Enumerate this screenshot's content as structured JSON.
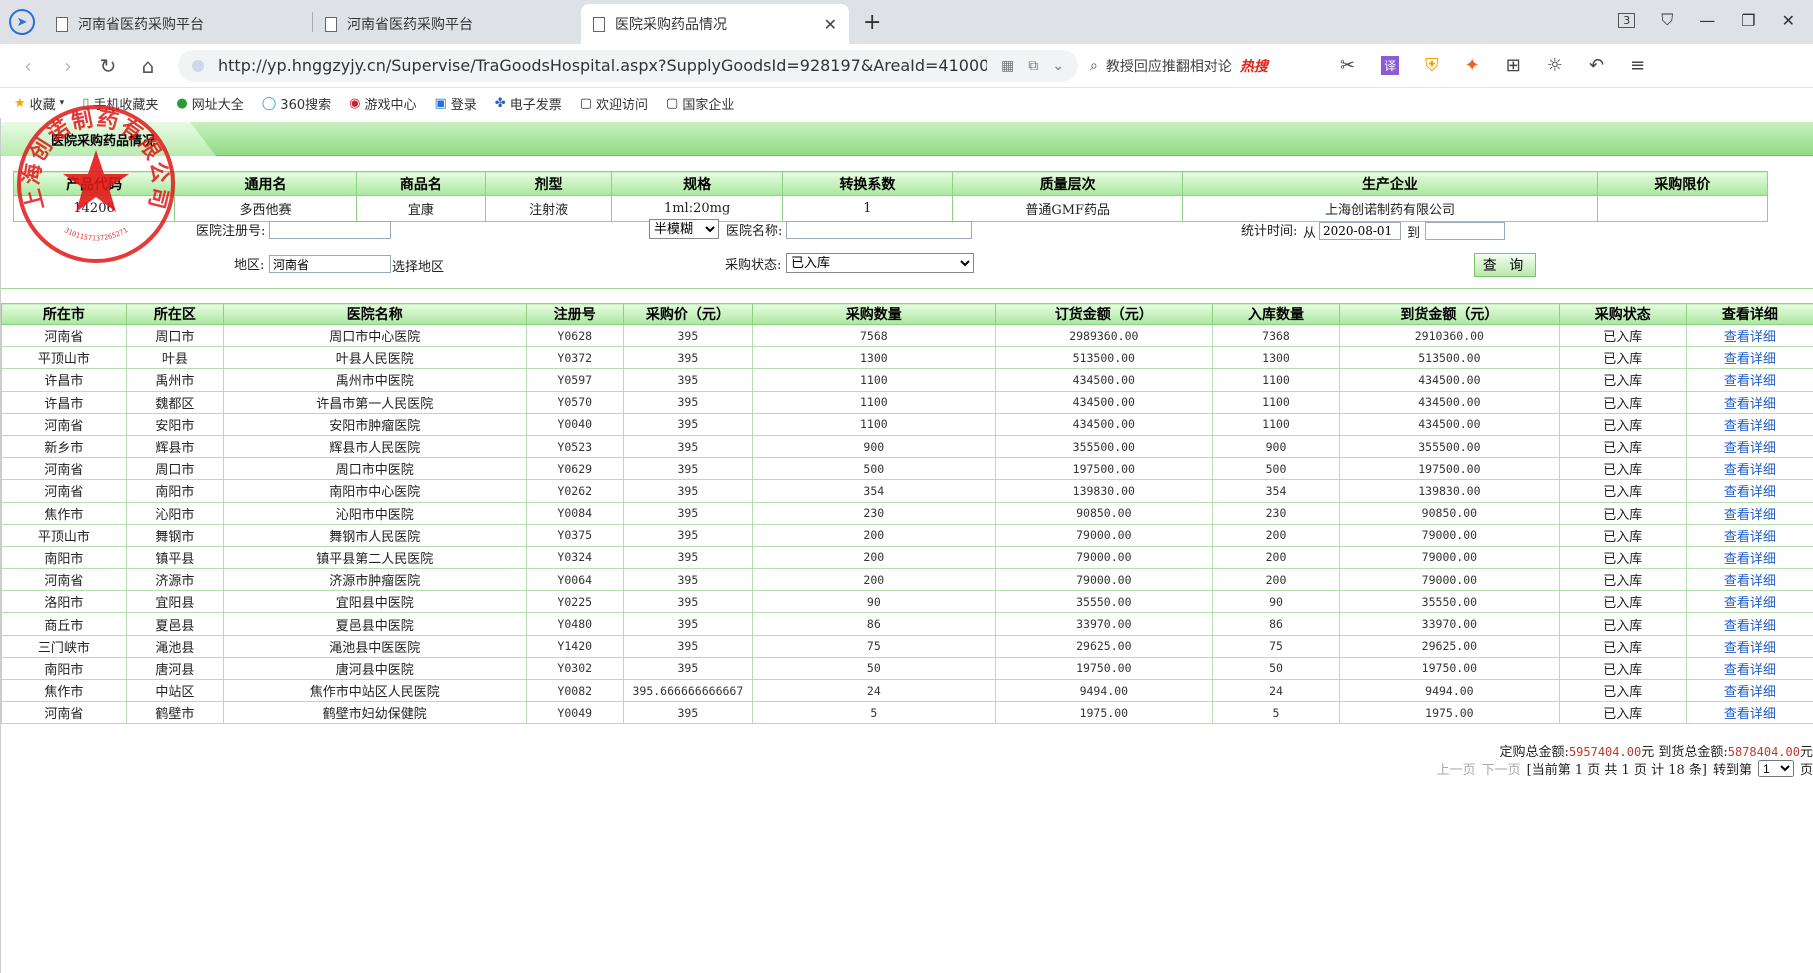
{
  "browser": {
    "tabs": [
      {
        "label": "河南省医药采购平台"
      },
      {
        "label": "河南省医药采购平台"
      },
      {
        "label": "医院采购药品情况"
      }
    ],
    "tab_counter": "3",
    "url": "http://yp.hnggzyjy.cn/Supervise/TraGoodsHospital.aspx?SupplyGoodsId=928197&AreaId=410000&",
    "search_text": "教授回应推翻相对论",
    "search_hot": "热搜",
    "bookmarks": [
      "收藏",
      "手机收藏夹",
      "网址大全",
      "360搜索",
      "游戏中心",
      "登录",
      "电子发票",
      "欢迎访问",
      "国家企业"
    ]
  },
  "panel": {
    "title": "医院采购药品情况"
  },
  "product": {
    "headers": [
      "产品代码",
      "通用名",
      "商品名",
      "剂型",
      "规格",
      "转换系数",
      "质量层次",
      "生产企业",
      "采购限价"
    ],
    "row": [
      "14206",
      "多西他赛",
      "宜康",
      "注射液",
      "1ml:20mg",
      "1",
      "普通GMF药品",
      "上海创诺制药有限公司",
      ""
    ]
  },
  "filters": {
    "reg_label": "医院注册号:",
    "reg_value": "",
    "match_mode": "半模糊",
    "name_label": "医院名称:",
    "name_value": "",
    "time_label": "统计时间:",
    "from_label": "从",
    "from_value": "2020-08-01",
    "to_label": "到",
    "to_value": "",
    "area_label": "地区:",
    "area_value": "河南省",
    "area_pick": "选择地区",
    "status_label": "采购状态:",
    "status_value": "已入库",
    "query_label": "查 询"
  },
  "table": {
    "headers": [
      "所在市",
      "所在区",
      "医院名称",
      "注册号",
      "采购价（元）",
      "采购数量",
      "订货金额（元）",
      "入库数量",
      "到货金额（元）",
      "采购状态",
      "查看详细"
    ],
    "link_label": "查看详细",
    "rows": [
      [
        "河南省",
        "周口市",
        "周口市中心医院",
        "Y0628",
        "395",
        "7568",
        "2989360.00",
        "7368",
        "2910360.00",
        "已入库"
      ],
      [
        "平顶山市",
        "叶县",
        "叶县人民医院",
        "Y0372",
        "395",
        "1300",
        "513500.00",
        "1300",
        "513500.00",
        "已入库"
      ],
      [
        "许昌市",
        "禹州市",
        "禹州市中医院",
        "Y0597",
        "395",
        "1100",
        "434500.00",
        "1100",
        "434500.00",
        "已入库"
      ],
      [
        "许昌市",
        "魏都区",
        "许昌市第一人民医院",
        "Y0570",
        "395",
        "1100",
        "434500.00",
        "1100",
        "434500.00",
        "已入库"
      ],
      [
        "河南省",
        "安阳市",
        "安阳市肿瘤医院",
        "Y0040",
        "395",
        "1100",
        "434500.00",
        "1100",
        "434500.00",
        "已入库"
      ],
      [
        "新乡市",
        "辉县市",
        "辉县市人民医院",
        "Y0523",
        "395",
        "900",
        "355500.00",
        "900",
        "355500.00",
        "已入库"
      ],
      [
        "河南省",
        "周口市",
        "周口市中医院",
        "Y0629",
        "395",
        "500",
        "197500.00",
        "500",
        "197500.00",
        "已入库"
      ],
      [
        "河南省",
        "南阳市",
        "南阳市中心医院",
        "Y0262",
        "395",
        "354",
        "139830.00",
        "354",
        "139830.00",
        "已入库"
      ],
      [
        "焦作市",
        "沁阳市",
        "沁阳市中医院",
        "Y0084",
        "395",
        "230",
        "90850.00",
        "230",
        "90850.00",
        "已入库"
      ],
      [
        "平顶山市",
        "舞钢市",
        "舞钢市人民医院",
        "Y0375",
        "395",
        "200",
        "79000.00",
        "200",
        "79000.00",
        "已入库"
      ],
      [
        "南阳市",
        "镇平县",
        "镇平县第二人民医院",
        "Y0324",
        "395",
        "200",
        "79000.00",
        "200",
        "79000.00",
        "已入库"
      ],
      [
        "河南省",
        "济源市",
        "济源市肿瘤医院",
        "Y0064",
        "395",
        "200",
        "79000.00",
        "200",
        "79000.00",
        "已入库"
      ],
      [
        "洛阳市",
        "宜阳县",
        "宜阳县中医院",
        "Y0225",
        "395",
        "90",
        "35550.00",
        "90",
        "35550.00",
        "已入库"
      ],
      [
        "商丘市",
        "夏邑县",
        "夏邑县中医院",
        "Y0480",
        "395",
        "86",
        "33970.00",
        "86",
        "33970.00",
        "已入库"
      ],
      [
        "三门峡市",
        "渑池县",
        "渑池县中医医院",
        "Y1420",
        "395",
        "75",
        "29625.00",
        "75",
        "29625.00",
        "已入库"
      ],
      [
        "南阳市",
        "唐河县",
        "唐河县中医院",
        "Y0302",
        "395",
        "50",
        "19750.00",
        "50",
        "19750.00",
        "已入库"
      ],
      [
        "焦作市",
        "中站区",
        "焦作市中站区人民医院",
        "Y0082",
        "395.666666666667",
        "24",
        "9494.00",
        "24",
        "9494.00",
        "已入库"
      ],
      [
        "河南省",
        "鹤壁市",
        "鹤壁市妇幼保健院",
        "Y0049",
        "395",
        "5",
        "1975.00",
        "5",
        "1975.00",
        "已入库"
      ]
    ]
  },
  "summary": {
    "order_label": "定购总金额:",
    "order_value": "5957404.00",
    "unit": "元",
    "arrive_label": "到货总金额:",
    "arrive_value": "5878404.00"
  },
  "pager": {
    "prev": "上一页",
    "next": "下一页",
    "info": "[当前第 1 页  共 1 页  计 18 条]",
    "goto": "转到第",
    "page": "1",
    "suffix": "页"
  },
  "stamp": {
    "text": "上海创诺制药有限公司",
    "number": "3101157137265271"
  }
}
